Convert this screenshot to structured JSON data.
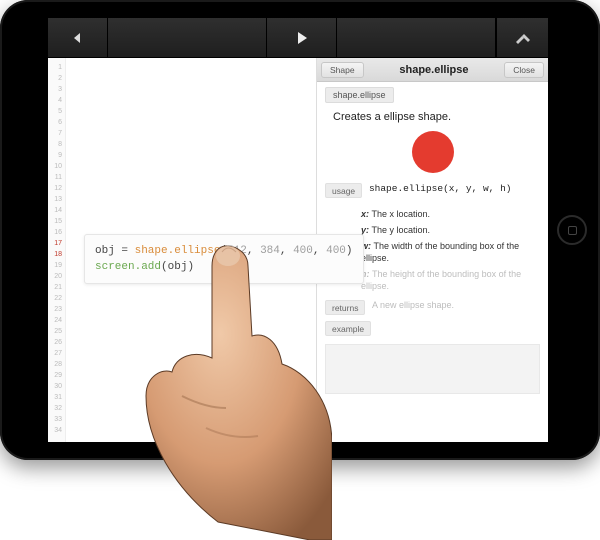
{
  "toolbar": {
    "back_icon": "arrow-left",
    "play_icon": "play",
    "tools_icon": "wrench-screwdriver"
  },
  "editor": {
    "line_count": 34,
    "highlight_lines": [
      17,
      18
    ],
    "code_lines": [
      {
        "tokens": [
          {
            "t": "obj ",
            "c": "tok-kw"
          },
          {
            "t": "= ",
            "c": "tok-kw"
          },
          {
            "t": "shape.ellipse",
            "c": "tok-call"
          },
          {
            "t": "(",
            "c": "tok-kw"
          },
          {
            "t": "512",
            "c": "tok-num"
          },
          {
            "t": ", ",
            "c": "tok-kw"
          },
          {
            "t": "384",
            "c": "tok-num"
          },
          {
            "t": ", ",
            "c": "tok-kw"
          },
          {
            "t": "400",
            "c": "tok-num"
          },
          {
            "t": ", ",
            "c": "tok-kw"
          },
          {
            "t": "400",
            "c": "tok-num"
          },
          {
            "t": ")",
            "c": "tok-kw"
          }
        ]
      },
      {
        "tokens": [
          {
            "t": "screen.add",
            "c": "tok-call2"
          },
          {
            "t": "(",
            "c": "tok-kw"
          },
          {
            "t": "obj",
            "c": "tok-kw"
          },
          {
            "t": ")",
            "c": "tok-kw"
          }
        ]
      }
    ]
  },
  "doc": {
    "shape_btn": "Shape",
    "title": "shape.ellipse",
    "close_btn": "Close",
    "breadcrumb": "shape.ellipse",
    "description": "Creates a ellipse shape.",
    "usage_tag": "usage",
    "signature": "shape.ellipse(x, y, w, h)",
    "params": [
      {
        "name": "x:",
        "desc": "The x location.",
        "faded": false
      },
      {
        "name": "y:",
        "desc": "The y location.",
        "faded": false
      },
      {
        "name": "w:",
        "desc": "The width of the bounding box of the ellipse.",
        "faded": false
      },
      {
        "name": "h:",
        "desc": "The height of the bounding box of the ellipse.",
        "faded": true
      }
    ],
    "returns_tag": "returns",
    "returns_value": "A new ellipse shape.",
    "example_tag": "example",
    "demo_color": "#e43b2f"
  }
}
